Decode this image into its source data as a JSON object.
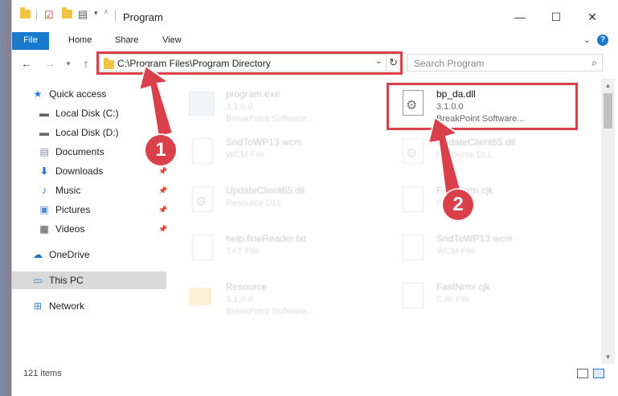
{
  "window": {
    "title": "Program",
    "controls": {
      "minimize": "—",
      "maximize": "☐",
      "close": "✕"
    }
  },
  "ribbon": {
    "tabs": [
      "File",
      "Home",
      "Share",
      "View"
    ],
    "help": "?",
    "expand": "⌄"
  },
  "nav": {
    "back": "←",
    "forward": "→",
    "up": "↑"
  },
  "address": {
    "path": "C:\\Program Files\\Program Directory",
    "dropdown": "⌄",
    "refresh": "↻"
  },
  "search": {
    "placeholder": "Search Program",
    "icon": "⌕"
  },
  "sidebar": {
    "items": [
      {
        "label": "Quick access",
        "icon": "star-icon"
      },
      {
        "label": "Local Disk (C:)",
        "icon": "drive-icon",
        "pinned": true
      },
      {
        "label": "Local Disk (D:)",
        "icon": "drive-icon",
        "pinned": true
      },
      {
        "label": "Documents",
        "icon": "documents-icon",
        "pinned": true
      },
      {
        "label": "Downloads",
        "icon": "download-icon",
        "pinned": true
      },
      {
        "label": "Music",
        "icon": "music-icon",
        "pinned": true
      },
      {
        "label": "Pictures",
        "icon": "pictures-icon",
        "pinned": true
      },
      {
        "label": "Videos",
        "icon": "videos-icon",
        "pinned": true
      },
      {
        "label": "OneDrive",
        "icon": "cloud-icon"
      },
      {
        "label": "This PC",
        "icon": "computer-icon",
        "selected": true
      },
      {
        "label": "Network",
        "icon": "network-icon"
      }
    ]
  },
  "files": [
    {
      "name": "program.exe",
      "line2": "3.1.0.0",
      "line3": "BreakPoint Software...",
      "icon": "exe-icon",
      "faded": true
    },
    {
      "name": "bp_da.dll",
      "line2": "3.1.0.0",
      "line3": "BreakPoint Software...",
      "icon": "dll-icon",
      "faded": false
    },
    {
      "name": "SndToWP13.wcm",
      "line2": "WCM File",
      "line3": "",
      "icon": "file-icon",
      "faded": true
    },
    {
      "name": "UpdateClient65.dll",
      "line2": "Resource DLL",
      "line3": "",
      "icon": "dll-icon",
      "faded": true
    },
    {
      "name": "UpdateClient65.dll",
      "line2": "Resource DLL",
      "line3": "",
      "icon": "dll-icon",
      "faded": true
    },
    {
      "name": "FastNorm.cjk",
      "line2": "CJK File",
      "line3": "",
      "icon": "file-icon",
      "faded": true
    },
    {
      "name": "help.fineReader.txt",
      "line2": "TXT File",
      "line3": "",
      "icon": "file-icon",
      "faded": true
    },
    {
      "name": "SndToWP13.wcm",
      "line2": "WCM File",
      "line3": "",
      "icon": "file-icon",
      "faded": true
    },
    {
      "name": "Resource",
      "line2": "3.1.0.0",
      "line3": "BreakPoint Software...",
      "icon": "folder-icon",
      "faded": true
    },
    {
      "name": "FastNrml.cjk",
      "line2": "CJK File",
      "line3": "",
      "icon": "file-icon",
      "faded": true
    }
  ],
  "status": {
    "item_count": "121 items"
  },
  "annotations": {
    "step1": "1",
    "step2": "2",
    "color": "#d9404a"
  }
}
